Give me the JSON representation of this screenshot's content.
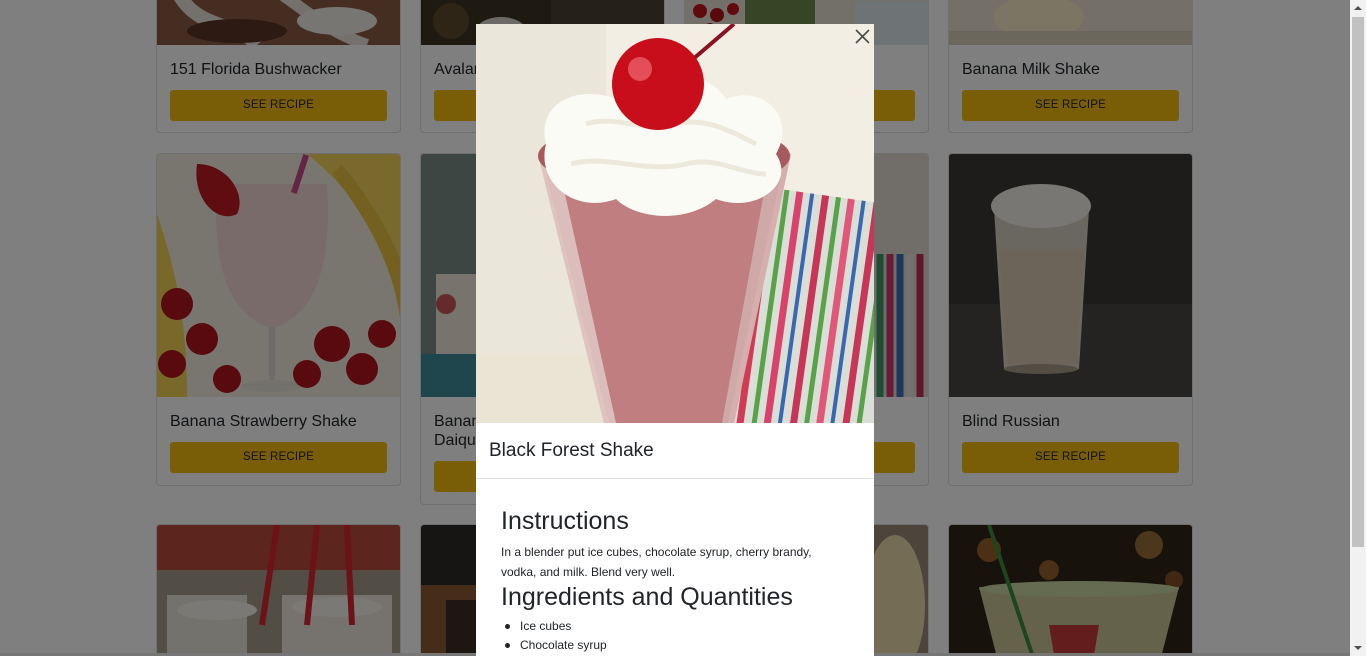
{
  "cards": [
    {
      "id": "bushwacker",
      "title": "151 Florida Bushwacker",
      "button": "SEE RECIPE"
    },
    {
      "id": "avalanche",
      "title": "Avalanche",
      "button": "SEE RECIPE"
    },
    {
      "id": "hidden-1",
      "title": "",
      "button": "SEE RECIPE"
    },
    {
      "id": "banana-milk",
      "title": "Banana Milk Shake",
      "button": "SEE RECIPE"
    },
    {
      "id": "banana-strawberry",
      "title": "Banana Strawberry Shake",
      "button": "SEE RECIPE"
    },
    {
      "id": "banana-daiquiri",
      "title": "Banana\nDaiquiri",
      "button": "SEE RECIPE"
    },
    {
      "id": "hidden-2",
      "title": "",
      "button": "SEE RECIPE"
    },
    {
      "id": "blind-russian",
      "title": "Blind Russian",
      "button": "SEE RECIPE"
    }
  ],
  "modal": {
    "title": "Black Forest Shake",
    "instructions_heading": "Instructions",
    "instructions": "In a blender put ice cubes, chocolate syrup, cherry brandy, vodka, and milk. Blend very well.",
    "ingredients_heading": "Ingredients and Quantities",
    "ingredients": [
      "Ice cubes",
      "Chocolate syrup"
    ],
    "close_icon": "close-icon"
  },
  "colors": {
    "button": "#f2bb0f",
    "backdrop": "rgba(0,0,0,0.5)"
  }
}
